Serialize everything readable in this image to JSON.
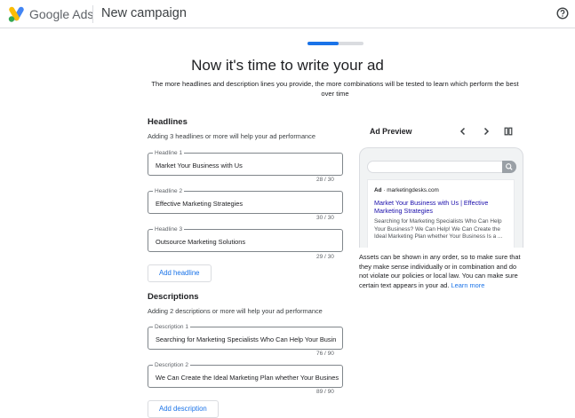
{
  "header": {
    "brand_google": "Google",
    "brand_ads": "Ads",
    "page_title": "New campaign",
    "help_icon": "help-circle-icon"
  },
  "progress": {
    "fraction": 0.55
  },
  "main": {
    "title": "Now it's time to write your ad",
    "subtitle": "The more headlines and description lines you provide, the more combinations will be tested to learn which perform the best over time"
  },
  "headlines": {
    "title": "Headlines",
    "hint": "Adding 3 headlines or more will help your ad performance",
    "items": [
      {
        "label": "Headline 1",
        "value": "Market Your Business with Us",
        "counter": "28 / 30"
      },
      {
        "label": "Headline 2",
        "value": "Effective Marketing Strategies",
        "counter": "30 / 30"
      },
      {
        "label": "Headline 3",
        "value": "Outsource Marketing Solutions",
        "counter": "29 / 30"
      }
    ],
    "add_label": "Add headline"
  },
  "descriptions": {
    "title": "Descriptions",
    "hint": "Adding 2 descriptions or more will help your ad performance",
    "items": [
      {
        "label": "Description 1",
        "value": "Searching for Marketing Specialists Who Can Help Your Busin",
        "counter": "76 / 90"
      },
      {
        "label": "Description 2",
        "value": "We Can Create the Ideal Marketing Plan whether Your Busines",
        "counter": "89 / 90"
      }
    ],
    "add_label": "Add description"
  },
  "preview": {
    "title": "Ad Preview",
    "prev_icon": "chevron-left-icon",
    "next_icon": "chevron-right-icon",
    "layout_icon": "columns-icon",
    "ad_badge": "Ad",
    "ad_domain": "· marketingdesks.com",
    "ad_title": "Market Your Business with Us | Effective Marketing Strategies",
    "ad_description": "Searching for Marketing Specialists Who Can Help Your Business? We Can Help! We Can Create the Ideal Marketing Plan whether Your Business Is a ...",
    "note": "Assets can be shown in any order, so to make sure that they make sense individually or in combination and do not violate our policies or local law. You can make sure certain text appears in your ad.",
    "learn_more": "Learn more"
  },
  "colors": {
    "accent": "#1a73e8",
    "ad_title": "#1a0dab"
  }
}
